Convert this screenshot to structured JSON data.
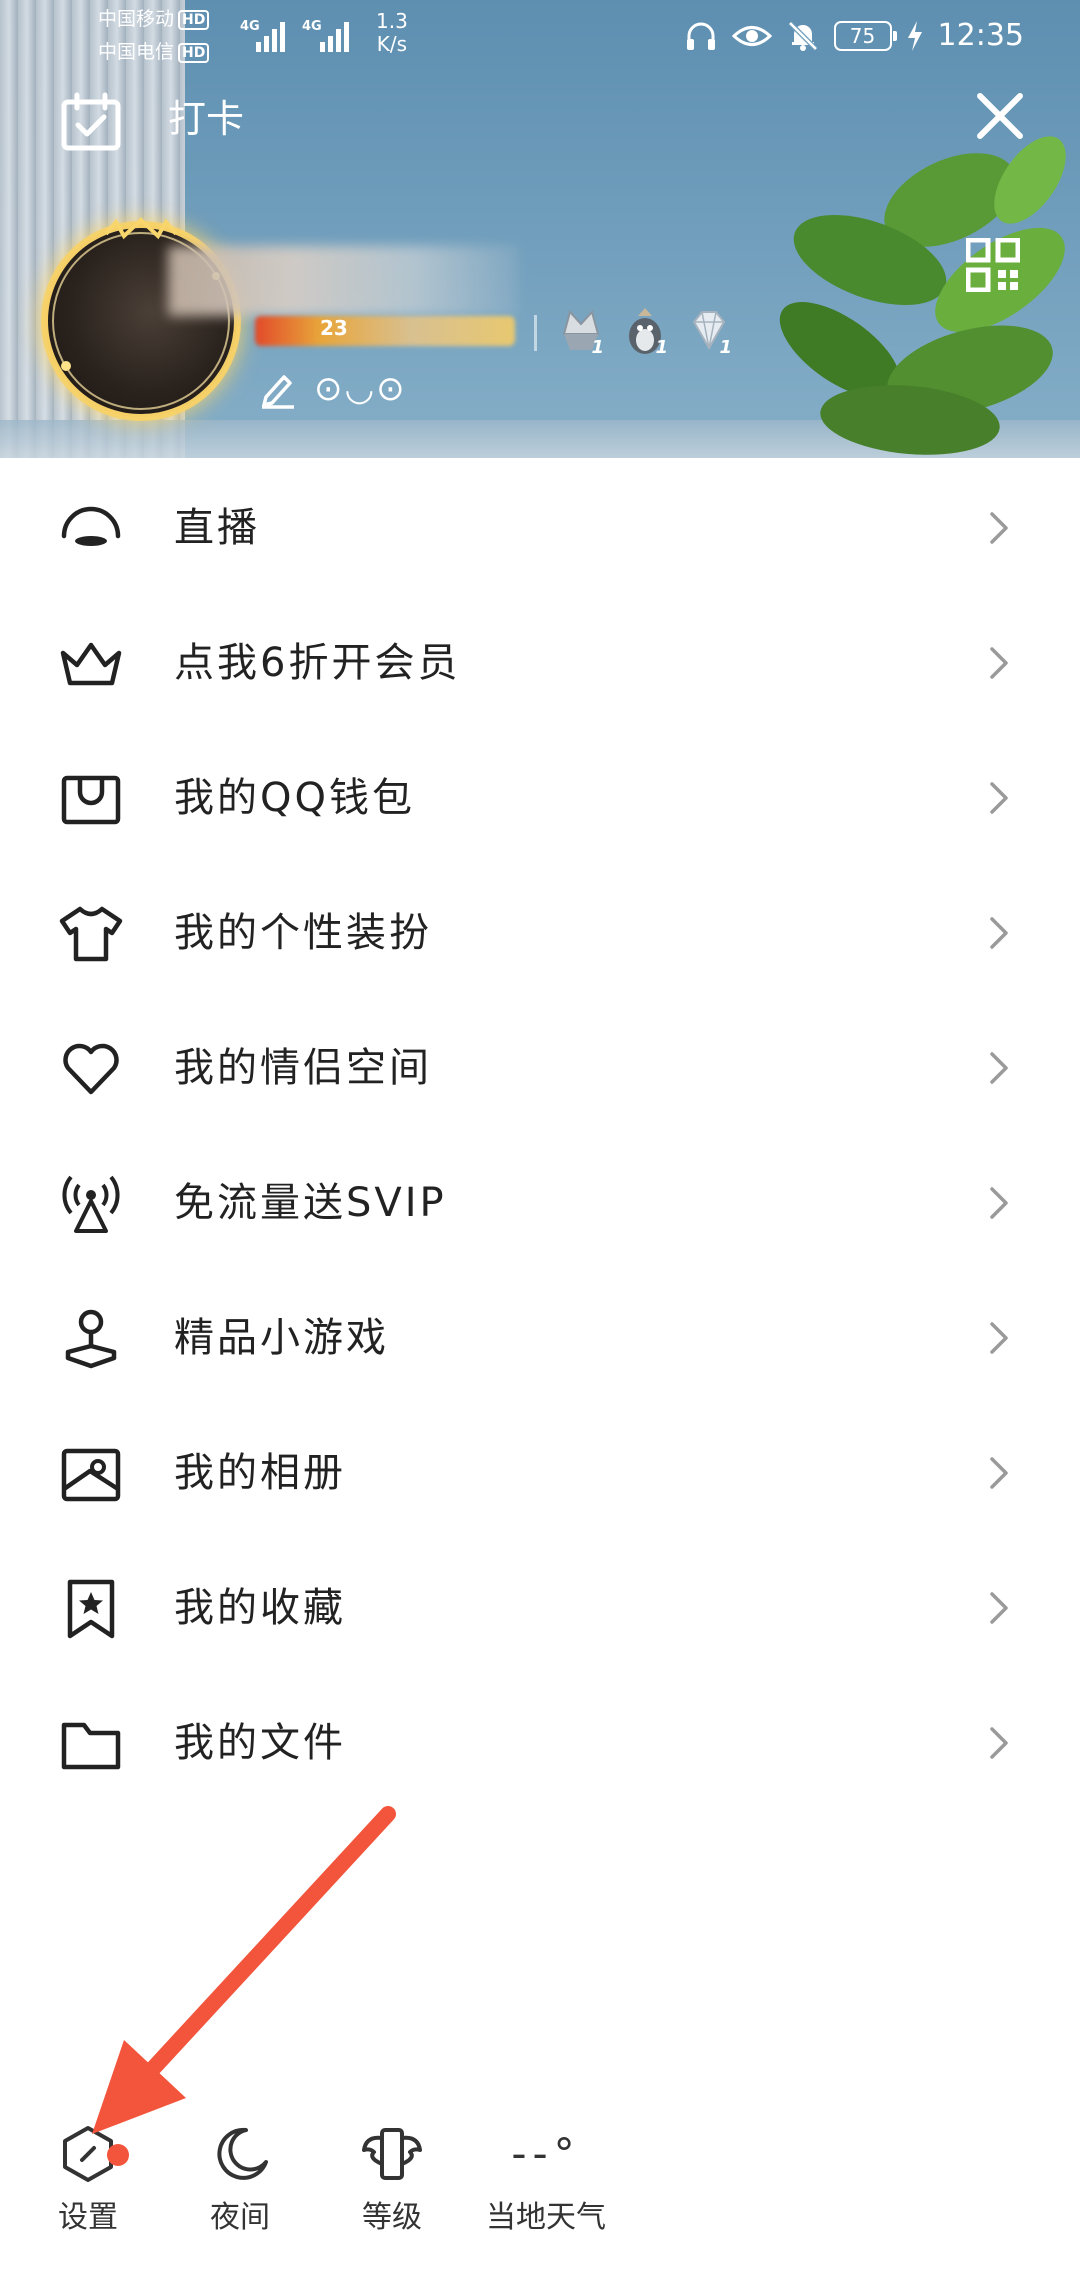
{
  "status_bar": {
    "carrier_1": "中国移动",
    "carrier_2": "中国电信",
    "hd": "HD",
    "net_type": "4G",
    "net_speed_value": "1.3",
    "net_speed_unit": "K/s",
    "battery": "75",
    "time": "12:35"
  },
  "header": {
    "checkin_label": "打卡",
    "level_number": "23",
    "badge_counts": [
      "1",
      "1",
      "1"
    ],
    "signature": "⊙◡⊙"
  },
  "menu": {
    "items": [
      {
        "label": "直播",
        "icon": "live-icon"
      },
      {
        "label": "点我6折开会员",
        "icon": "crown-icon"
      },
      {
        "label": "我的QQ钱包",
        "icon": "wallet-icon"
      },
      {
        "label": "我的个性装扮",
        "icon": "tshirt-icon"
      },
      {
        "label": "我的情侣空间",
        "icon": "heart-icon"
      },
      {
        "label": "免流量送SVIP",
        "icon": "signal-tower-icon"
      },
      {
        "label": "精品小游戏",
        "icon": "joystick-icon"
      },
      {
        "label": "我的相册",
        "icon": "album-icon"
      },
      {
        "label": "我的收藏",
        "icon": "bookmark-star-icon"
      },
      {
        "label": "我的文件",
        "icon": "folder-icon"
      }
    ]
  },
  "bottom_bar": {
    "settings": "设置",
    "night": "夜间",
    "level": "等级",
    "weather": "当地天气",
    "weather_value": "--°"
  },
  "colors": {
    "arrow": "#f2553c",
    "text": "#222222",
    "chevron": "#9a9a9a"
  }
}
